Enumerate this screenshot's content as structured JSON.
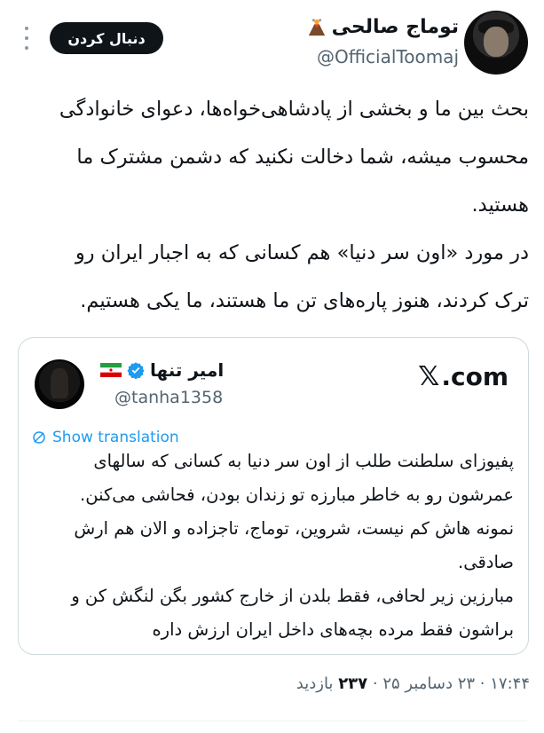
{
  "author": {
    "name": "توماج صالحی",
    "emoji_icon": "volcano-icon",
    "handle": "@OfficialToomaj"
  },
  "follow_button": {
    "label": "دنبال کردن"
  },
  "tweet": {
    "paragraphs": [
      "بحث بین ما و بخشی از پادشاهی‌خواه‌ها، دعوای خانوادگی محسوب میشه، شما دخالت نکنید که دشمن مشترک ما هستید.",
      "در مورد «اون سر دنیا» هم کسانی که به اجبار ایران رو ترک کردند، هنوز پاره‌های تن ما هستند، ما یکی هستیم."
    ]
  },
  "quoted": {
    "name": "امیر تنها",
    "handle": "@tanha1358",
    "source": ".com",
    "verified": true,
    "verified_color": "#1d9bf0",
    "flag": "iran-flag-icon",
    "show_translation": "Show translation",
    "paragraphs": [
      "پفیوزای سلطنت طلب از اون سر دنیا به کسانی که سالهای عمرشون رو به خاطر مبارزه تو زندان بودن، فحاشی می‌کنن.",
      "نمونه هاش کم نیست، شروین، توماج، تاجزاده و الان هم ارش صادقی.",
      "مبارزین زیر لحافی، فقط بلدن از خارج کشور بگن لنگش کن و براشون فقط مرده بچه‌های داخل ایران ارزش داره"
    ]
  },
  "meta": {
    "time": "۱۷:۴۴",
    "date": "۲۳ دسامبر ۲۵",
    "views": "۲۳۷",
    "views_label": "بازدید"
  },
  "colors": {
    "text": "#0f1419",
    "secondary": "#536471",
    "link": "#1d9bf0",
    "border": "#cfd9de"
  }
}
